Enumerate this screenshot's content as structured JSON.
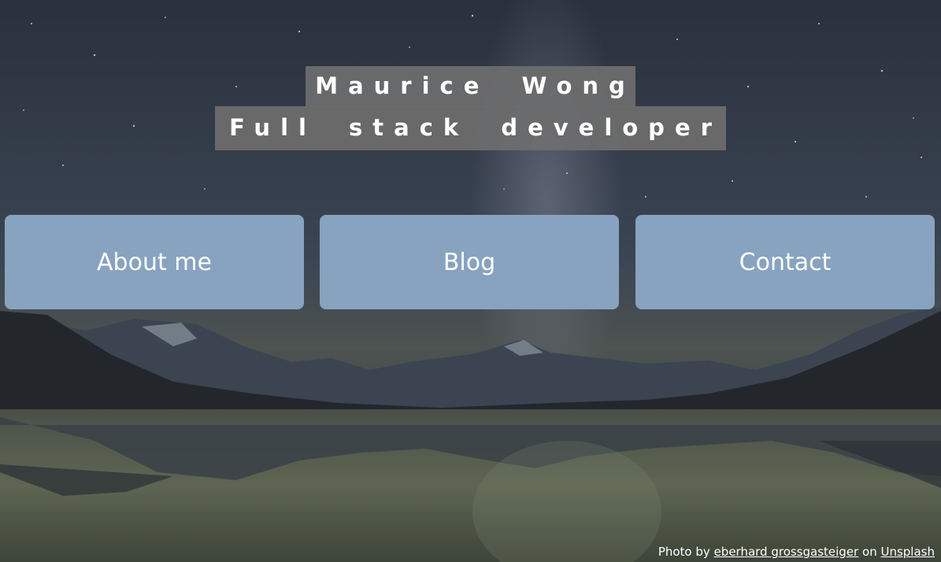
{
  "header": {
    "name": "Maurice Wong",
    "role": "Full stack developer"
  },
  "nav": {
    "items": [
      {
        "label": "About me"
      },
      {
        "label": "Blog"
      },
      {
        "label": "Contact"
      }
    ]
  },
  "credit": {
    "prefix": "Photo by",
    "author": "eberhard grossgasteiger",
    "middle": "on",
    "site": "Unsplash"
  },
  "colors": {
    "button_bg": "#87a3c0",
    "title_bg": "#6e6e6e",
    "text": "#ffffff"
  }
}
